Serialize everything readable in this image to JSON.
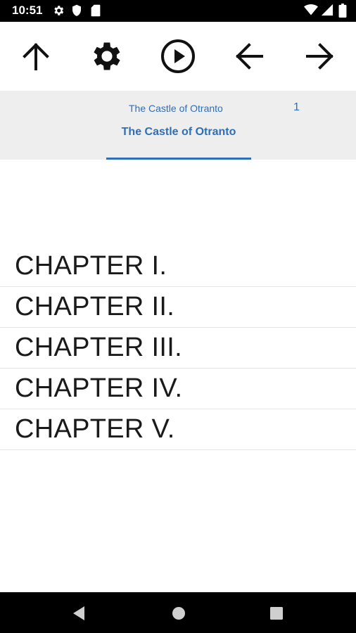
{
  "status_bar": {
    "time": "10:51",
    "left_icons": [
      "gear-icon",
      "shield-icon",
      "sd-card-icon"
    ],
    "right_icons": [
      "wifi-icon",
      "cellular-signal-icon",
      "battery-icon"
    ]
  },
  "toolbar": {
    "buttons": [
      {
        "name": "up-arrow-button",
        "icon": "arrow-up-icon"
      },
      {
        "name": "settings-button",
        "icon": "gear-icon"
      },
      {
        "name": "play-button",
        "icon": "play-circle-icon"
      },
      {
        "name": "back-button",
        "icon": "arrow-left-icon"
      },
      {
        "name": "forward-button",
        "icon": "arrow-right-icon"
      }
    ]
  },
  "header": {
    "book_title": "The Castle of Otranto",
    "page_number": "1",
    "active_tab": "The Castle of Otranto",
    "accent_color": "#2f6fb5"
  },
  "chapters": [
    {
      "label": "CHAPTER I."
    },
    {
      "label": "CHAPTER II."
    },
    {
      "label": "CHAPTER III."
    },
    {
      "label": "CHAPTER IV."
    },
    {
      "label": "CHAPTER V."
    }
  ],
  "nav_bar": {
    "buttons": [
      "back-triangle-icon",
      "home-circle-icon",
      "recents-square-icon"
    ]
  }
}
